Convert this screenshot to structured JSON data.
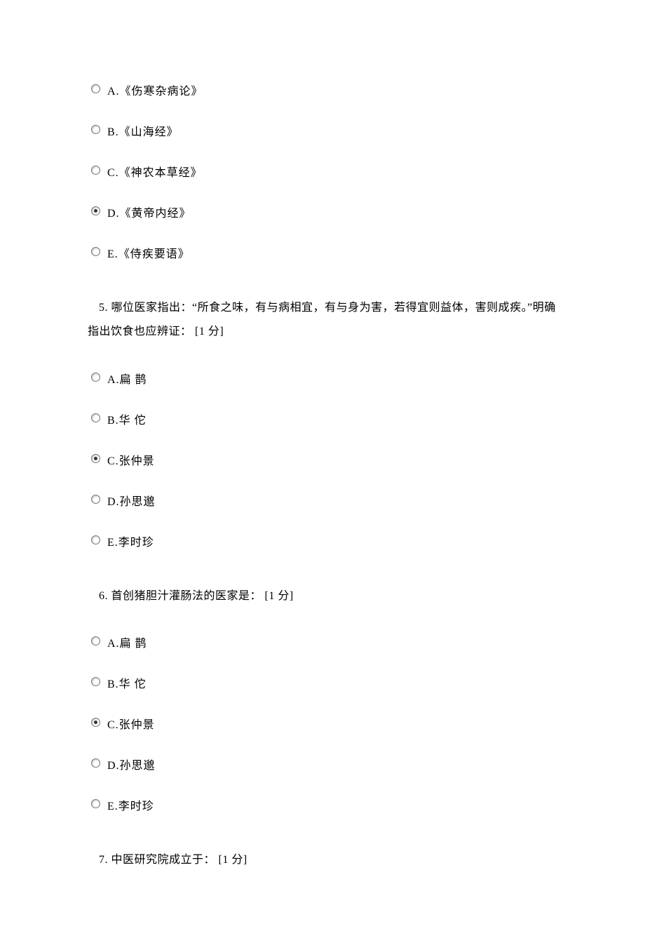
{
  "q4": {
    "options": {
      "a": "A.《伤寒杂病论》",
      "b": "B.《山海经》",
      "c": "C.《神农本草经》",
      "d": "D.《黄帝内经》",
      "e": "E.《侍疾要语》"
    }
  },
  "q5": {
    "text": "5. 哪位医家指出：“所食之味，有与病相宜，有与身为害，若得宜则益体，害则成疾。”明确指出饮食也应辨证：  [1 分]",
    "options": {
      "a": "A.扁  鹊",
      "b": "B.华  佗",
      "c": "C.张仲景",
      "d": "D.孙思邈",
      "e": "E.李时珍"
    }
  },
  "q6": {
    "text": "6. 首创猪胆汁灌肠法的医家是：  [1 分]",
    "options": {
      "a": "A.扁  鹊",
      "b": "B.华  佗",
      "c": "C.张仲景",
      "d": "D.孙思邈",
      "e": "E.李时珍"
    }
  },
  "q7": {
    "text": "7. 中医研究院成立于：  [1 分]"
  }
}
